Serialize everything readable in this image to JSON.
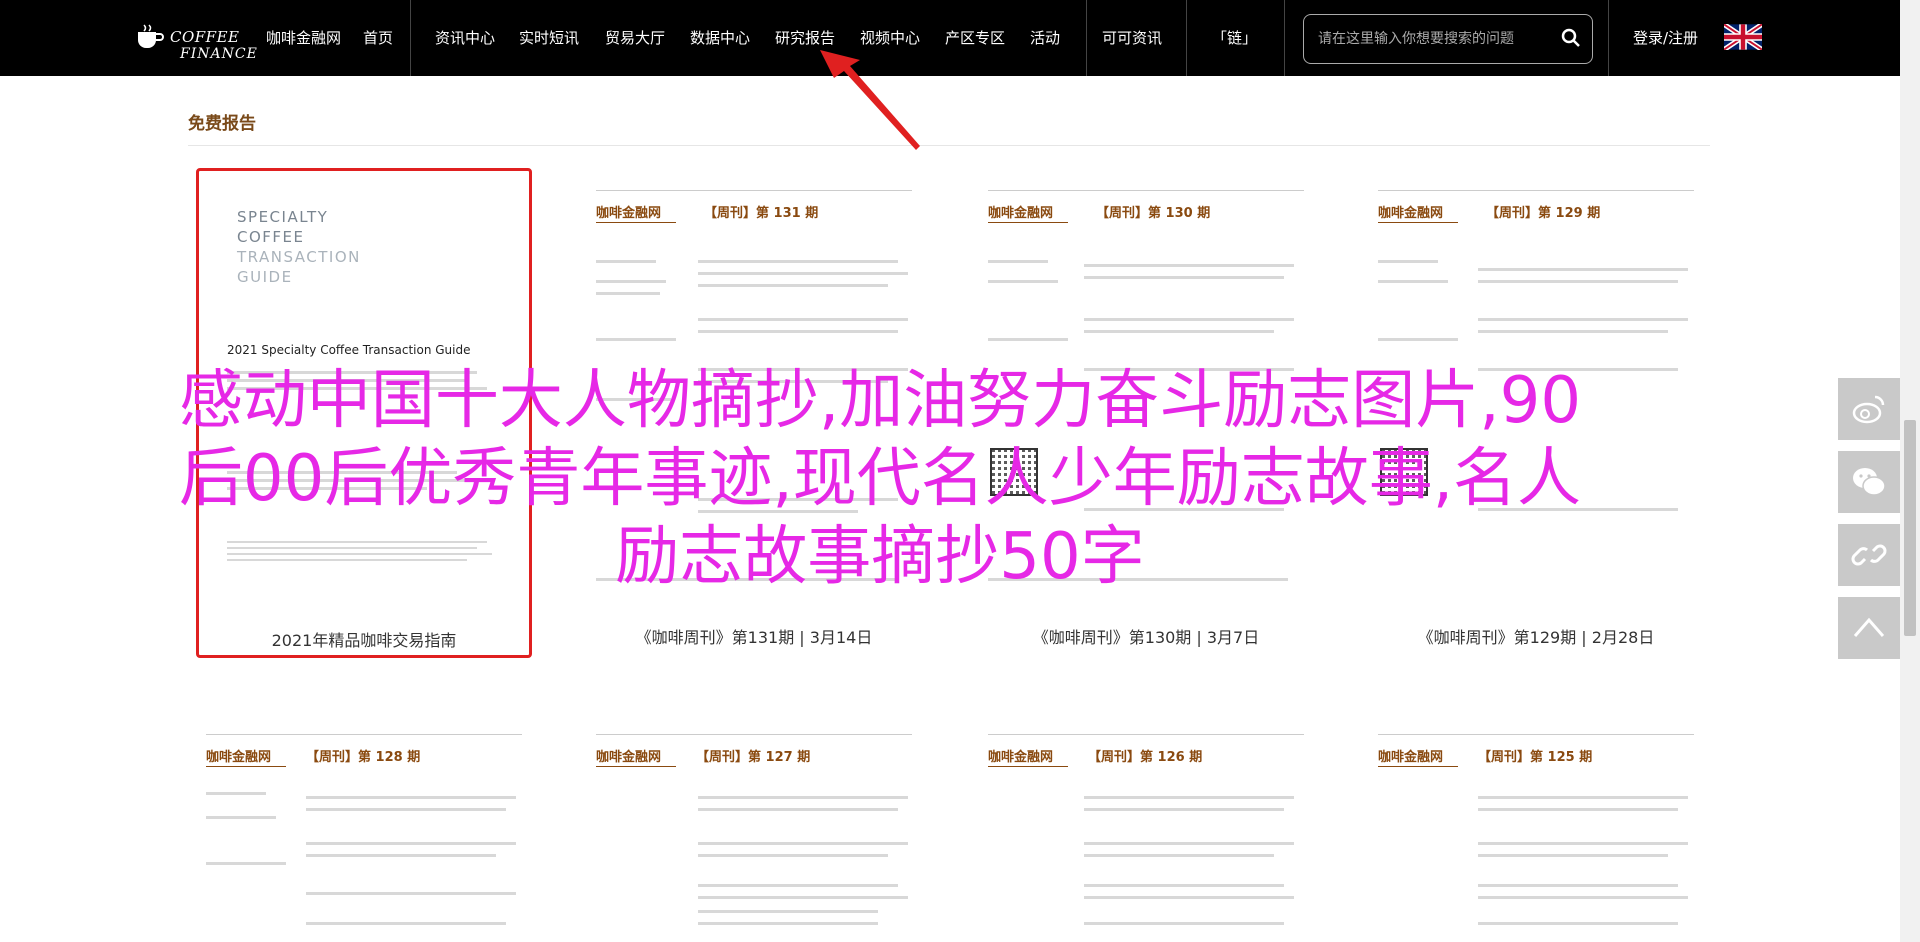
{
  "header": {
    "logo_line1": "COFFEE",
    "logo_line2": "FINANCE",
    "nav": [
      {
        "label": "咖啡金融网"
      },
      {
        "label": "首页"
      },
      {
        "label": "资讯中心"
      },
      {
        "label": "实时短讯"
      },
      {
        "label": "贸易大厅"
      },
      {
        "label": "数据中心"
      },
      {
        "label": "研究报告"
      },
      {
        "label": "视频中心"
      },
      {
        "label": "产区专区"
      },
      {
        "label": "活动"
      },
      {
        "label": "可可资讯"
      },
      {
        "label": "「链」"
      }
    ],
    "search_placeholder": "请在这里输入你想要搜索的问题",
    "login_label": "登录/注册"
  },
  "section": {
    "title": "免费报告"
  },
  "reports_row1": [
    {
      "caption": "2021年精品咖啡交易指南",
      "cover_lines": [
        "SPECIALTY",
        "COFFEE",
        "TRANSACTION",
        "GUIDE"
      ],
      "cover_subtitle": "2021 Specialty Coffee Transaction Guide"
    },
    {
      "brand": "咖啡金融网",
      "issue": "【周刊】第 131 期",
      "caption": "《咖啡周刊》第131期 | 3月14日"
    },
    {
      "brand": "咖啡金融网",
      "issue": "【周刊】第 130 期",
      "caption": "《咖啡周刊》第130期 | 3月7日"
    },
    {
      "brand": "咖啡金融网",
      "issue": "【周刊】第 129 期",
      "caption": "《咖啡周刊》第129期 | 2月28日"
    }
  ],
  "reports_row2": [
    {
      "brand": "咖啡金融网",
      "issue": "【周刊】第 128 期"
    },
    {
      "brand": "咖啡金融网",
      "issue": "【周刊】第 127 期"
    },
    {
      "brand": "咖啡金融网",
      "issue": "【周刊】第 126 期"
    },
    {
      "brand": "咖啡金融网",
      "issue": "【周刊】第 125 期"
    }
  ],
  "overlay": {
    "line1": "感动中国十大人物摘抄,加油努力奋斗励志图片,90",
    "line2": "后00后优秀青年事迹,现代名人少年励志故事,名人",
    "line3": "励志故事摘抄50字"
  },
  "colors": {
    "overlay": "#e628e6",
    "highlight": "#e02020",
    "brand": "#8a4a10"
  },
  "share_icons": [
    "weibo-icon",
    "wechat-icon",
    "link-icon",
    "back-to-top-icon"
  ]
}
